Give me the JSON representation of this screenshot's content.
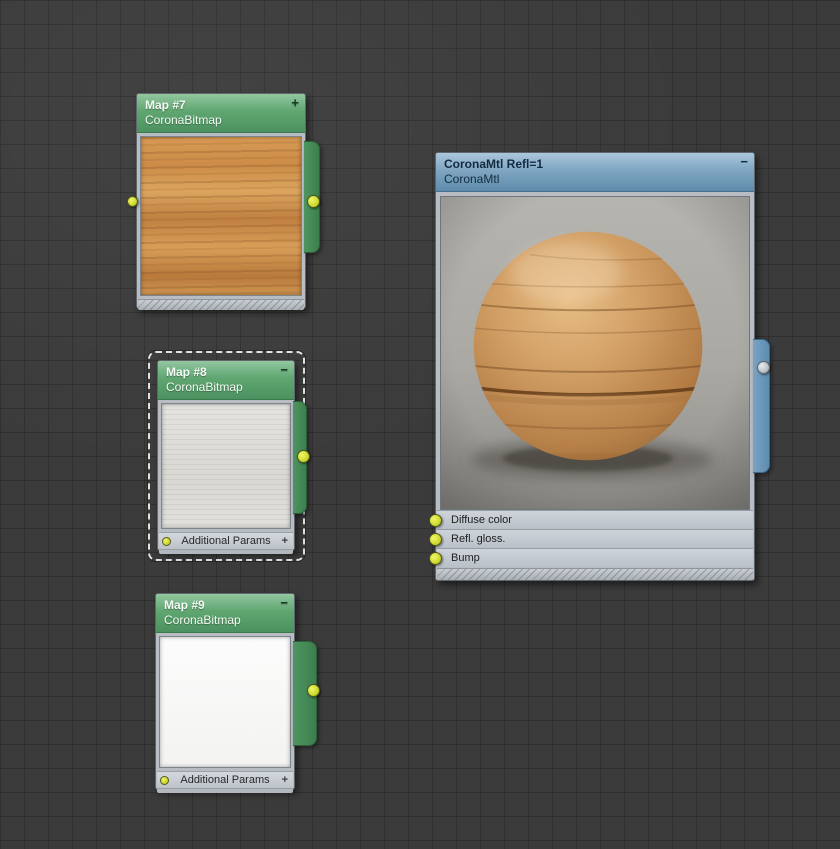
{
  "graph": {
    "nodes": {
      "map7": {
        "title": "Map #7",
        "subtitle": "CoronaBitmap",
        "collapse_icon": "+"
      },
      "map8": {
        "title": "Map #8",
        "subtitle": "CoronaBitmap",
        "collapse_icon": "−",
        "params_label": "Additional Params",
        "params_icon": "+"
      },
      "map9": {
        "title": "Map #9",
        "subtitle": "CoronaBitmap",
        "collapse_icon": "−",
        "params_label": "Additional Params",
        "params_icon": "+"
      },
      "material": {
        "title": "CoronaMtl Refl=1",
        "subtitle": "CoronaMtl",
        "collapse_icon": "−",
        "slots": [
          {
            "label": "Diffuse color"
          },
          {
            "label": "Refl. gloss."
          },
          {
            "label": "Bump"
          }
        ]
      }
    },
    "connections": [
      {
        "from": "Map #7",
        "to": "Diffuse color"
      },
      {
        "from": "Map #8",
        "to": "Refl. gloss."
      },
      {
        "from": "Map #9",
        "to": "Bump"
      }
    ],
    "colors": {
      "wire": "#c5362b",
      "socket": "#cdd92e",
      "map_header": "#5fa671",
      "material_header": "#7fa6c2",
      "background": "#3b3b3b"
    }
  }
}
